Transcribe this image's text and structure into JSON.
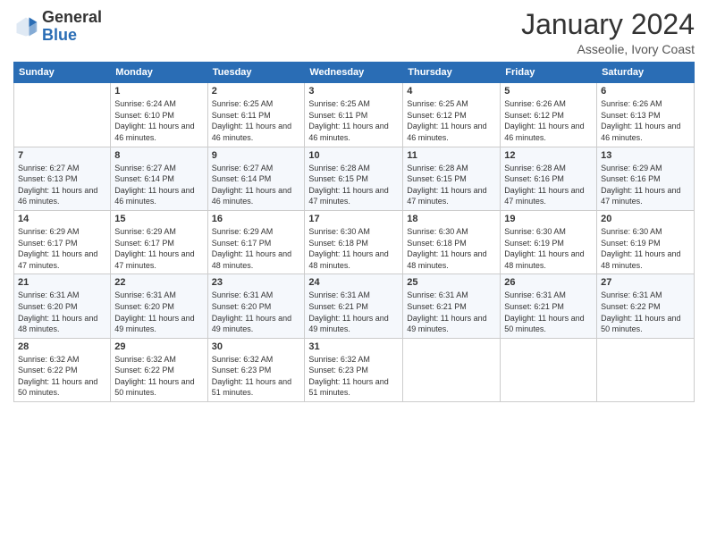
{
  "logo": {
    "general": "General",
    "blue": "Blue"
  },
  "header": {
    "month": "January 2024",
    "location": "Asseolie, Ivory Coast"
  },
  "weekdays": [
    "Sunday",
    "Monday",
    "Tuesday",
    "Wednesday",
    "Thursday",
    "Friday",
    "Saturday"
  ],
  "weeks": [
    [
      {
        "day": "",
        "sunrise": "",
        "sunset": "",
        "daylight": ""
      },
      {
        "day": "1",
        "sunrise": "Sunrise: 6:24 AM",
        "sunset": "Sunset: 6:10 PM",
        "daylight": "Daylight: 11 hours and 46 minutes."
      },
      {
        "day": "2",
        "sunrise": "Sunrise: 6:25 AM",
        "sunset": "Sunset: 6:11 PM",
        "daylight": "Daylight: 11 hours and 46 minutes."
      },
      {
        "day": "3",
        "sunrise": "Sunrise: 6:25 AM",
        "sunset": "Sunset: 6:11 PM",
        "daylight": "Daylight: 11 hours and 46 minutes."
      },
      {
        "day": "4",
        "sunrise": "Sunrise: 6:25 AM",
        "sunset": "Sunset: 6:12 PM",
        "daylight": "Daylight: 11 hours and 46 minutes."
      },
      {
        "day": "5",
        "sunrise": "Sunrise: 6:26 AM",
        "sunset": "Sunset: 6:12 PM",
        "daylight": "Daylight: 11 hours and 46 minutes."
      },
      {
        "day": "6",
        "sunrise": "Sunrise: 6:26 AM",
        "sunset": "Sunset: 6:13 PM",
        "daylight": "Daylight: 11 hours and 46 minutes."
      }
    ],
    [
      {
        "day": "7",
        "sunrise": "Sunrise: 6:27 AM",
        "sunset": "Sunset: 6:13 PM",
        "daylight": "Daylight: 11 hours and 46 minutes."
      },
      {
        "day": "8",
        "sunrise": "Sunrise: 6:27 AM",
        "sunset": "Sunset: 6:14 PM",
        "daylight": "Daylight: 11 hours and 46 minutes."
      },
      {
        "day": "9",
        "sunrise": "Sunrise: 6:27 AM",
        "sunset": "Sunset: 6:14 PM",
        "daylight": "Daylight: 11 hours and 46 minutes."
      },
      {
        "day": "10",
        "sunrise": "Sunrise: 6:28 AM",
        "sunset": "Sunset: 6:15 PM",
        "daylight": "Daylight: 11 hours and 47 minutes."
      },
      {
        "day": "11",
        "sunrise": "Sunrise: 6:28 AM",
        "sunset": "Sunset: 6:15 PM",
        "daylight": "Daylight: 11 hours and 47 minutes."
      },
      {
        "day": "12",
        "sunrise": "Sunrise: 6:28 AM",
        "sunset": "Sunset: 6:16 PM",
        "daylight": "Daylight: 11 hours and 47 minutes."
      },
      {
        "day": "13",
        "sunrise": "Sunrise: 6:29 AM",
        "sunset": "Sunset: 6:16 PM",
        "daylight": "Daylight: 11 hours and 47 minutes."
      }
    ],
    [
      {
        "day": "14",
        "sunrise": "Sunrise: 6:29 AM",
        "sunset": "Sunset: 6:17 PM",
        "daylight": "Daylight: 11 hours and 47 minutes."
      },
      {
        "day": "15",
        "sunrise": "Sunrise: 6:29 AM",
        "sunset": "Sunset: 6:17 PM",
        "daylight": "Daylight: 11 hours and 47 minutes."
      },
      {
        "day": "16",
        "sunrise": "Sunrise: 6:29 AM",
        "sunset": "Sunset: 6:17 PM",
        "daylight": "Daylight: 11 hours and 48 minutes."
      },
      {
        "day": "17",
        "sunrise": "Sunrise: 6:30 AM",
        "sunset": "Sunset: 6:18 PM",
        "daylight": "Daylight: 11 hours and 48 minutes."
      },
      {
        "day": "18",
        "sunrise": "Sunrise: 6:30 AM",
        "sunset": "Sunset: 6:18 PM",
        "daylight": "Daylight: 11 hours and 48 minutes."
      },
      {
        "day": "19",
        "sunrise": "Sunrise: 6:30 AM",
        "sunset": "Sunset: 6:19 PM",
        "daylight": "Daylight: 11 hours and 48 minutes."
      },
      {
        "day": "20",
        "sunrise": "Sunrise: 6:30 AM",
        "sunset": "Sunset: 6:19 PM",
        "daylight": "Daylight: 11 hours and 48 minutes."
      }
    ],
    [
      {
        "day": "21",
        "sunrise": "Sunrise: 6:31 AM",
        "sunset": "Sunset: 6:20 PM",
        "daylight": "Daylight: 11 hours and 48 minutes."
      },
      {
        "day": "22",
        "sunrise": "Sunrise: 6:31 AM",
        "sunset": "Sunset: 6:20 PM",
        "daylight": "Daylight: 11 hours and 49 minutes."
      },
      {
        "day": "23",
        "sunrise": "Sunrise: 6:31 AM",
        "sunset": "Sunset: 6:20 PM",
        "daylight": "Daylight: 11 hours and 49 minutes."
      },
      {
        "day": "24",
        "sunrise": "Sunrise: 6:31 AM",
        "sunset": "Sunset: 6:21 PM",
        "daylight": "Daylight: 11 hours and 49 minutes."
      },
      {
        "day": "25",
        "sunrise": "Sunrise: 6:31 AM",
        "sunset": "Sunset: 6:21 PM",
        "daylight": "Daylight: 11 hours and 49 minutes."
      },
      {
        "day": "26",
        "sunrise": "Sunrise: 6:31 AM",
        "sunset": "Sunset: 6:21 PM",
        "daylight": "Daylight: 11 hours and 50 minutes."
      },
      {
        "day": "27",
        "sunrise": "Sunrise: 6:31 AM",
        "sunset": "Sunset: 6:22 PM",
        "daylight": "Daylight: 11 hours and 50 minutes."
      }
    ],
    [
      {
        "day": "28",
        "sunrise": "Sunrise: 6:32 AM",
        "sunset": "Sunset: 6:22 PM",
        "daylight": "Daylight: 11 hours and 50 minutes."
      },
      {
        "day": "29",
        "sunrise": "Sunrise: 6:32 AM",
        "sunset": "Sunset: 6:22 PM",
        "daylight": "Daylight: 11 hours and 50 minutes."
      },
      {
        "day": "30",
        "sunrise": "Sunrise: 6:32 AM",
        "sunset": "Sunset: 6:23 PM",
        "daylight": "Daylight: 11 hours and 51 minutes."
      },
      {
        "day": "31",
        "sunrise": "Sunrise: 6:32 AM",
        "sunset": "Sunset: 6:23 PM",
        "daylight": "Daylight: 11 hours and 51 minutes."
      },
      {
        "day": "",
        "sunrise": "",
        "sunset": "",
        "daylight": ""
      },
      {
        "day": "",
        "sunrise": "",
        "sunset": "",
        "daylight": ""
      },
      {
        "day": "",
        "sunrise": "",
        "sunset": "",
        "daylight": ""
      }
    ]
  ]
}
